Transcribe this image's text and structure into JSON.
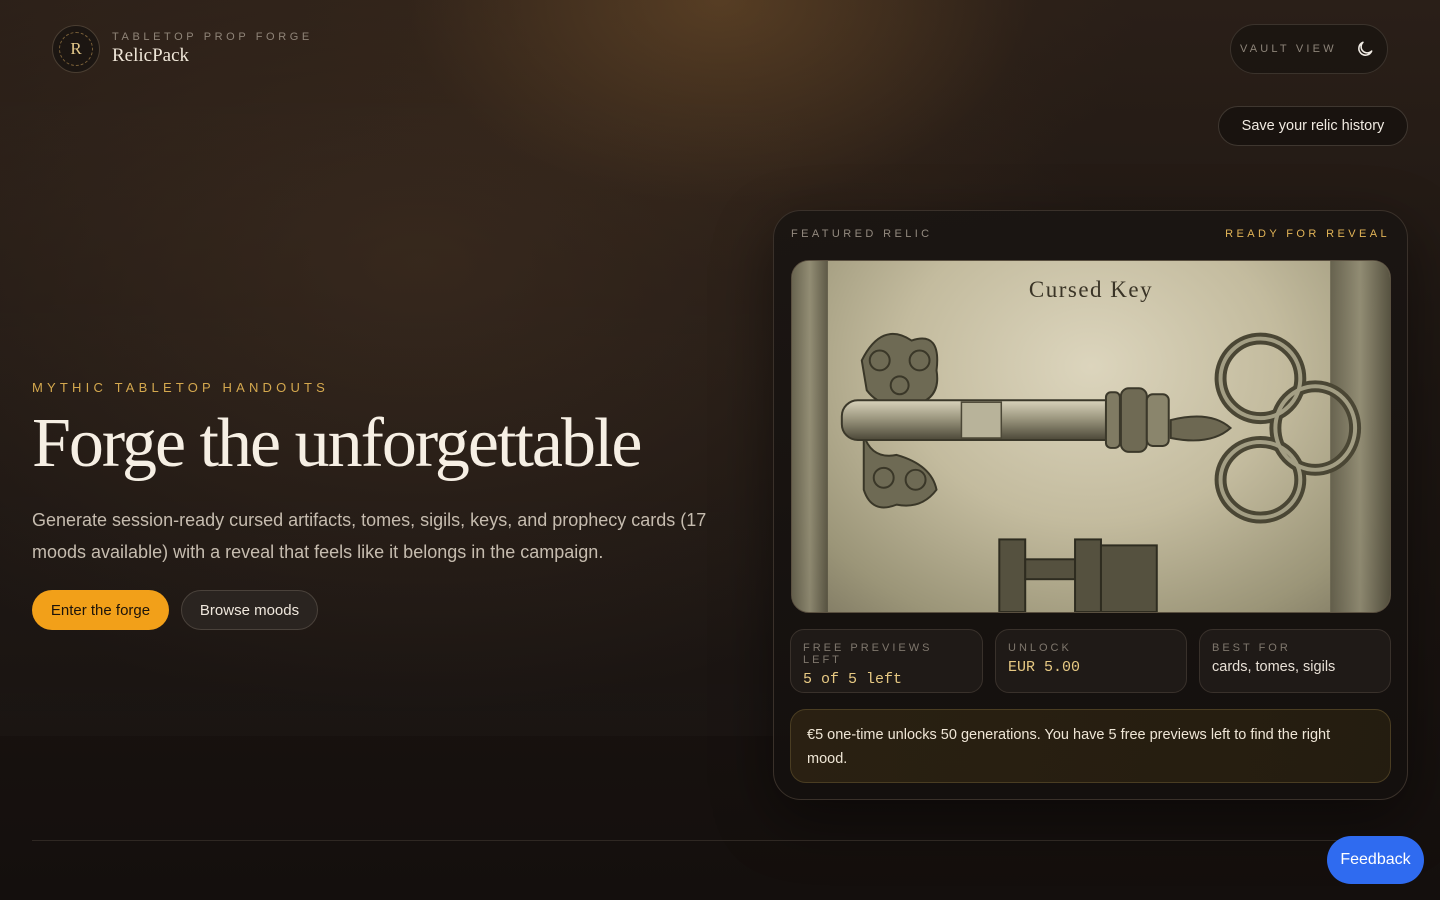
{
  "brand": {
    "monogram": "R",
    "kicker": "TABLETOP PROP FORGE",
    "name": "RelicPack"
  },
  "header": {
    "vault_label": "VAULT VIEW",
    "theme_icon": "moon-icon",
    "save_history_label": "Save your relic history"
  },
  "hero": {
    "kicker": "MYTHIC TABLETOP HANDOUTS",
    "title": "Forge the unforgettable",
    "description": "Generate session-ready cursed artifacts, tomes, sigils, keys, and prophecy cards (17 moods available) with a reveal that feels like it belongs in the campaign.",
    "primary_cta": "Enter the forge",
    "secondary_cta": "Browse moods"
  },
  "featured": {
    "kicker": "FEATURED RELIC",
    "status": "READY FOR REVEAL",
    "image_caption": "Cursed Key",
    "stats": [
      {
        "label": "FREE PREVIEWS LEFT",
        "value": "5 of 5 left"
      },
      {
        "label": "UNLOCK",
        "value": "EUR 5.00"
      },
      {
        "label": "BEST FOR",
        "value": "cards, tomes, sigils"
      }
    ],
    "notice": "€5 one-time unlocks 50 generations. You have 5 free previews left to find the right mood."
  },
  "feedback_label": "Feedback",
  "colors": {
    "accent": "#f2a019",
    "gold_text": "#d4a84e",
    "feedback_blue": "#2f6bf0"
  }
}
